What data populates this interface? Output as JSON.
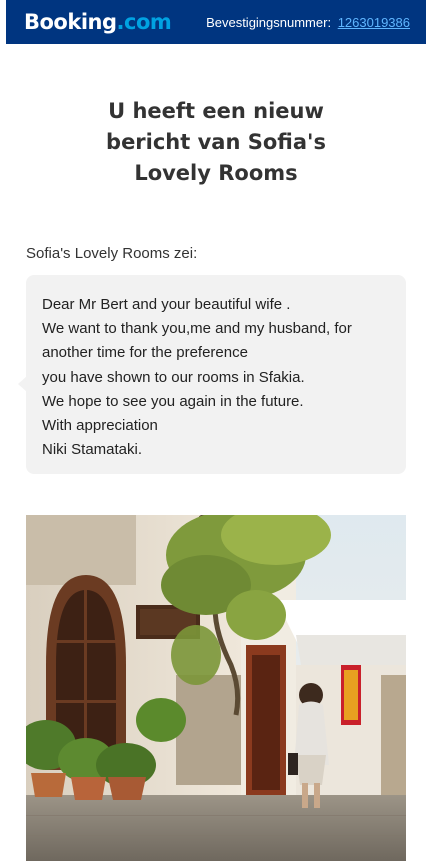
{
  "header": {
    "logo_main": "Booking",
    "logo_suffix": ".com",
    "confirmation_label": "Bevestigingsnummer:",
    "confirmation_number": "1263019386"
  },
  "title": "U heeft een nieuw bericht van Sofia's Lovely Rooms",
  "sender_line": "Sofia's Lovely Rooms zei:",
  "message": {
    "lines": [
      "Dear Mr Bert and your beautiful wife .",
      "We want to thank you,me and my husband, for",
      "another time for the preference",
      "you have shown to our rooms in Sfakia.",
      "We hope to see you again in the future.",
      "With appreciation",
      "Niki Stamataki."
    ]
  },
  "colors": {
    "brand_dark_blue": "#003580",
    "brand_light_blue": "#00a2e2",
    "link_blue": "#5fb6ff",
    "bubble_bg": "#f2f2f2"
  }
}
